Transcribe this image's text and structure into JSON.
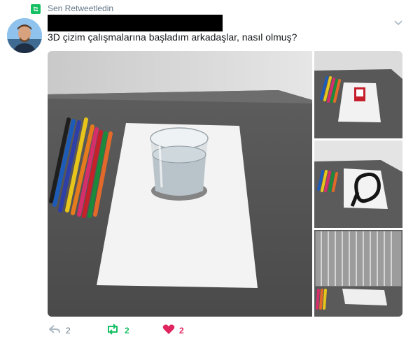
{
  "context": {
    "label": "Sen Retweetledin",
    "icon": "retweet-icon",
    "color": "#17bf63"
  },
  "author": {
    "avatar": "avatar",
    "name": ""
  },
  "tweet": {
    "text": "3D çizim çalışmalarına başladım arkadaşlar, nasıl olmuş?"
  },
  "media": {
    "main": "photo-glass-on-paper",
    "thumbs": [
      "photo-matchbox-on-paper",
      "photo-strap-on-paper",
      "photo-heater"
    ]
  },
  "actions": {
    "reply": {
      "icon": "reply-icon",
      "count": "2"
    },
    "retweet": {
      "icon": "retweet-icon",
      "count": "2"
    },
    "like": {
      "icon": "heart-icon",
      "count": "2"
    }
  },
  "colors": {
    "retweet": "#17bf63",
    "like": "#e0245e",
    "muted": "#657786"
  }
}
